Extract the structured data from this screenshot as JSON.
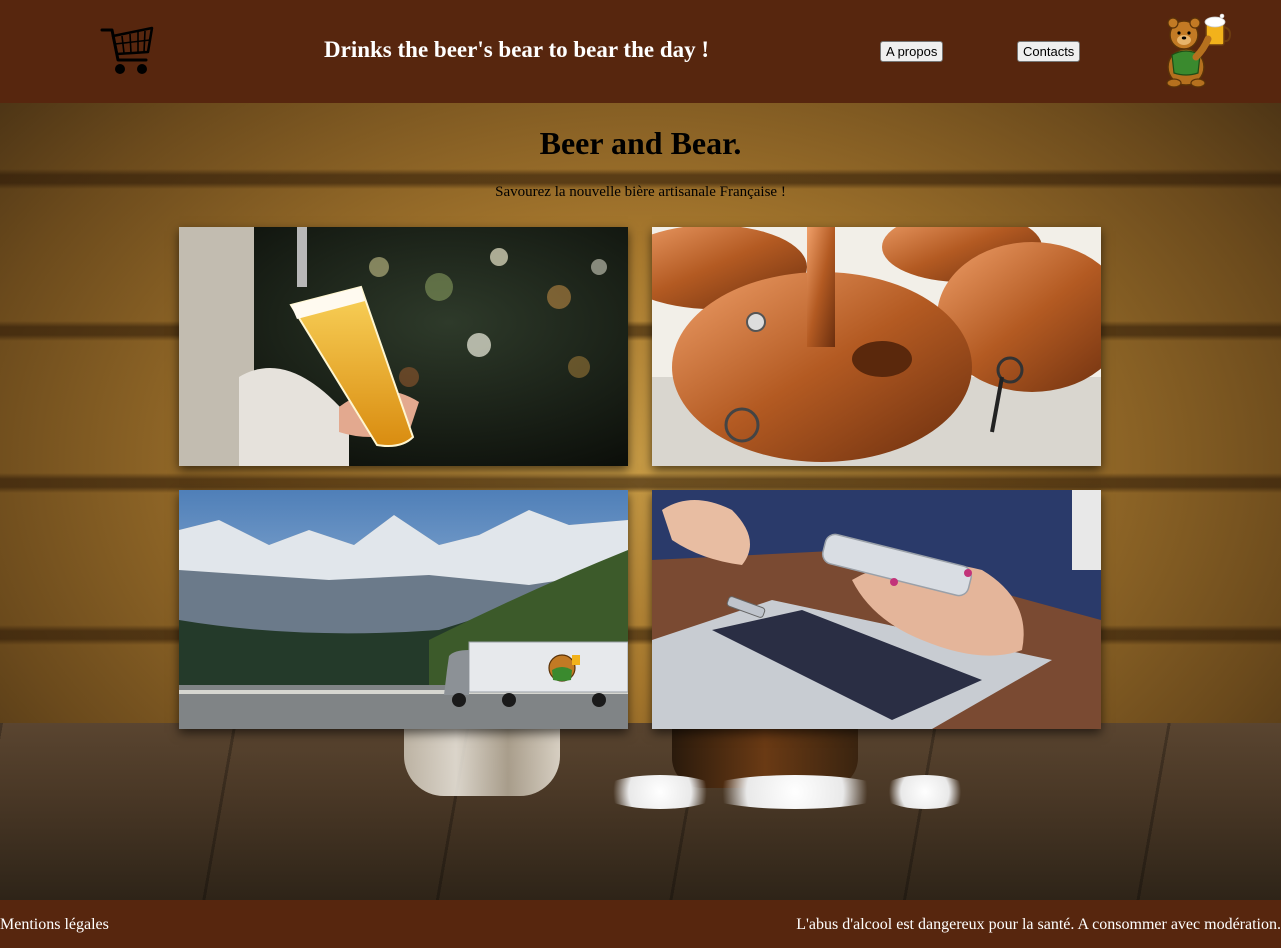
{
  "header": {
    "title": "Drinks the beer's bear to bear the day !",
    "nav": {
      "apropos": "A propos",
      "contacts": "Contacts"
    },
    "cart_icon": "shopping-cart-icon",
    "logo_icon": "bear-beer-logo"
  },
  "main": {
    "title": "Beer and Bear.",
    "subtitle": "Savourez la nouvelle bière artisanale Française !",
    "tiles": [
      {
        "subject": "beer-pour-photo"
      },
      {
        "subject": "brewery-copper-kettles-photo"
      },
      {
        "subject": "mountain-truck-photo"
      },
      {
        "subject": "phone-laptop-photo"
      }
    ]
  },
  "footer": {
    "legal": "Mentions légales",
    "warning": "L'abus d'alcool est dangereux pour la santé. A consommer avec modération."
  },
  "colors": {
    "header_bg": "#57260e",
    "footer_bg": "#57260e",
    "text_light": "#ffffff"
  }
}
